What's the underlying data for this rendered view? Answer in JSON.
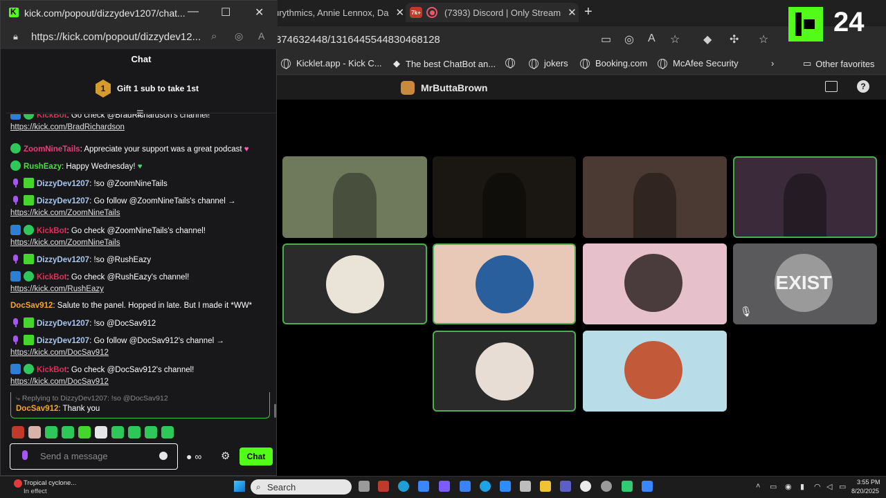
{
  "browser": {
    "tabs": [
      {
        "label": "urythmics, Annie Lennox, Da"
      },
      {
        "label": "(7393) Discord | Only Stream",
        "badge": "7k+"
      }
    ],
    "url": "374632448/1316445544830468128",
    "favorites": [
      "Kicklet.app - Kick C...",
      "The best ChatBot an...",
      "jokers",
      "Booking.com",
      "McAfee Security"
    ],
    "other_favorites": "Other favorites"
  },
  "discord": {
    "caller": "MrButtaBrown",
    "tiles": [
      {
        "kind": "video",
        "color": "#6f7a5c",
        "speaking": false
      },
      {
        "kind": "video",
        "color": "#1a1612",
        "speaking": false
      },
      {
        "kind": "video",
        "color": "#4b3a33",
        "speaking": false
      },
      {
        "kind": "video",
        "color": "#3a2a3a",
        "speaking": true
      },
      {
        "kind": "avatar",
        "color": "#2b2b2b",
        "pfp": "#e9e3d8",
        "speaking": true
      },
      {
        "kind": "avatar",
        "color": "#e8c9b8",
        "pfp": "#2a5f9e",
        "speaking": true
      },
      {
        "kind": "avatar",
        "color": "#e6c1cc",
        "pfp": "#4a3c3c",
        "speaking": false
      },
      {
        "kind": "avatar",
        "color": "#5a5a5c",
        "pfp": "#9a9a9a",
        "speaking": false,
        "label": "EXIST",
        "muted": true
      },
      {
        "kind": "avatar",
        "color": "#2a2a2a",
        "pfp": "#e8ddd4",
        "speaking": true
      },
      {
        "kind": "avatar",
        "color": "#b9dde8",
        "pfp": "#c25a3a",
        "speaking": false
      }
    ]
  },
  "kick_overlay": {
    "viewer_count": "24"
  },
  "popout": {
    "title": "kick.com/popout/dizzydev1207/chat...",
    "url": "https://kick.com/popout/dizzydev12..."
  },
  "chat": {
    "header": "Chat",
    "gift_rank": "1",
    "gift_text": "Gift 1 sub to take 1st",
    "messages": [
      {
        "user": "KickBot",
        "cls": "u-bot",
        "badges": [
          "bot",
          "verified"
        ],
        "text": ": Go check @BradRichardson's channel!",
        "link": "https://kick.com/BradRichardson"
      },
      {
        "user": "ZoomNineTails",
        "cls": "u-zoom",
        "badges": [
          "verified"
        ],
        "text": ": Appreciate your support was a great podcast",
        "emoji": "♥",
        "emoji_cls": "heart-pink"
      },
      {
        "user": "RushEazy",
        "cls": "u-green",
        "badges": [
          "verified"
        ],
        "text": ": Happy Wednesday!",
        "emoji": "♥",
        "emoji_cls": "heart-green"
      },
      {
        "user": "DizzyDev1207",
        "cls": "u-dizzy",
        "badges": [
          "mic",
          "sub"
        ],
        "text": ": !so @ZoomNineTails"
      },
      {
        "user": "DizzyDev1207",
        "cls": "u-dizzy",
        "badges": [
          "mic",
          "sub"
        ],
        "text": ": Go follow @ZoomNineTails's channel →",
        "link": "https://kick.com/ZoomNineTails"
      },
      {
        "user": "KickBot",
        "cls": "u-bot",
        "badges": [
          "bot",
          "verified"
        ],
        "text": ": Go check @ZoomNineTails's channel!",
        "link": "https://kick.com/ZoomNineTails"
      },
      {
        "user": "DizzyDev1207",
        "cls": "u-dizzy",
        "badges": [
          "mic",
          "sub"
        ],
        "text": ": !so @RushEazy"
      },
      {
        "user": "KickBot",
        "cls": "u-bot",
        "badges": [
          "bot",
          "verified"
        ],
        "text": ": Go check @RushEazy's channel!",
        "link": "https://kick.com/RushEazy"
      },
      {
        "user": "DocSav912",
        "cls": "u-doc",
        "badges": [],
        "text": ": Salute to the panel. Hopped in late. But I made it *WW*"
      },
      {
        "user": "DizzyDev1207",
        "cls": "u-dizzy",
        "badges": [
          "mic",
          "sub"
        ],
        "text": ": !so @DocSav912"
      },
      {
        "user": "DizzyDev1207",
        "cls": "u-dizzy",
        "badges": [
          "mic",
          "sub"
        ],
        "text": ": Go follow @DocSav912's channel →",
        "link": "https://kick.com/DocSav912"
      },
      {
        "user": "KickBot",
        "cls": "u-bot",
        "badges": [
          "bot",
          "verified"
        ],
        "text": ": Go check @DocSav912's channel!",
        "link": "https://kick.com/DocSav912"
      }
    ],
    "reply": {
      "ref": "Replying to DizzyDev1207: !so @DocSav912",
      "user": "DocSav912",
      "text": ": Thank you"
    },
    "emote_colors": [
      "#c0392b",
      "#d8b4a8",
      "#2fc65a",
      "#2fc65a",
      "#44d62c",
      "#e6e6e6",
      "#2fc65a",
      "#2fc65a",
      "#2fc65a",
      "#2fc65a"
    ],
    "input_placeholder": "Send a message",
    "send_label": "Chat"
  },
  "taskbar": {
    "weather_title": "Tropical cyclone...",
    "weather_sub": "In effect",
    "search_label": "Search",
    "time": "3:55 PM",
    "date": "8/20/2025"
  }
}
